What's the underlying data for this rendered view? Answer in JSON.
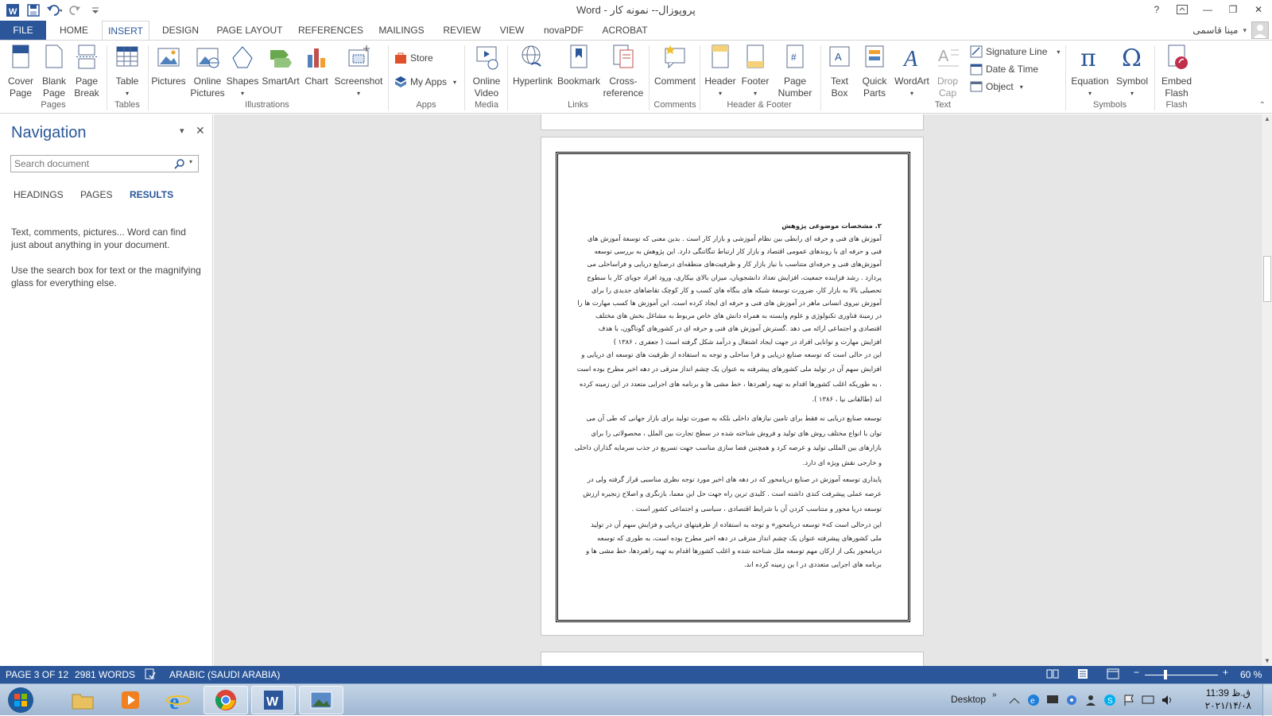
{
  "window": {
    "title": "Word - پروپوزال-- نمونه کار",
    "help": "?",
    "minimize": "—",
    "restore": "❐",
    "close": "✕"
  },
  "tabs": [
    "FILE",
    "HOME",
    "INSERT",
    "DESIGN",
    "PAGE LAYOUT",
    "REFERENCES",
    "MAILINGS",
    "REVIEW",
    "VIEW",
    "novaPDF",
    "ACROBAT"
  ],
  "active_tab": "INSERT",
  "user": {
    "name": "مینا قاسمی"
  },
  "ribbon": {
    "pages": {
      "label": "Pages",
      "cover": "Cover\nPage",
      "blank": "Blank\nPage",
      "break": "Page\nBreak"
    },
    "tables": {
      "label": "Tables",
      "table": "Table"
    },
    "illustrations": {
      "label": "Illustrations",
      "pictures": "Pictures",
      "online_pictures": "Online\nPictures",
      "shapes": "Shapes",
      "smartart": "SmartArt",
      "chart": "Chart",
      "screenshot": "Screenshot"
    },
    "apps": {
      "label": "Apps",
      "store": "Store",
      "my_apps": "My Apps"
    },
    "media": {
      "label": "Media",
      "online_video": "Online\nVideo"
    },
    "links": {
      "label": "Links",
      "hyperlink": "Hyperlink",
      "bookmark": "Bookmark",
      "cross_reference": "Cross-\nreference"
    },
    "comments": {
      "label": "Comments",
      "comment": "Comment"
    },
    "header_footer": {
      "label": "Header & Footer",
      "header": "Header",
      "footer": "Footer",
      "page_number": "Page\nNumber"
    },
    "text": {
      "label": "Text",
      "text_box": "Text\nBox",
      "quick_parts": "Quick\nParts",
      "wordart": "WordArt",
      "drop_cap": "Drop\nCap",
      "signature_line": "Signature Line",
      "date_time": "Date & Time",
      "object": "Object"
    },
    "symbols": {
      "label": "Symbols",
      "equation": "Equation",
      "symbol": "Symbol"
    },
    "flash": {
      "label": "Flash",
      "embed_flash": "Embed\nFlash"
    }
  },
  "navigation": {
    "title": "Navigation",
    "search_placeholder": "Search document",
    "tabs": [
      "HEADINGS",
      "PAGES",
      "RESULTS"
    ],
    "active_tab": "RESULTS",
    "hint1": "Text, comments, pictures... Word can find just about anything in your document.",
    "hint2": "Use the search box for text or the magnifying glass for everything else."
  },
  "document": {
    "heading": "۲. مشخصات موضوعی پژوهش",
    "lines": [
      "آموزش های فنی و حرفه ای رابطی بین نظام آموزشی و بازار کار است .  بدین معنی  که توسعة آموزش های",
      "فنی و حرفه ای با روندهای عمومی اقتصاد و بازار کار ارتباط  تنگاتنگی دارد. این پژوهش به بررسی توسعه",
      "آموزش‌های فنی و حرفه‌ای متناسب با نیاز بازار کار و ظرفیت‌های منطقه‌ای درصنایع دریایی و فراساحلی     می",
      "پردازد . رشد فزاینده جمعیت، افزایش تعداد دانشجویان، میزان بالای بیکاری، ورود افراد جویای کار با سطوح",
      "تحصیلی بالا به بازار کار، ضرورت توسعة شبکه های بنگاه های کسب و کار کوچک  تقاضاهای جدیدی را برای",
      "آموزش نیروی انسانی ماهر در آموزش های فنی و حرفه ای ایجاد کرده است. این آموزش ها کسب مهارت ها را",
      "در زمینة فناوری تکنولوژی و علوم وابسته به همراه دانش های خاص مربوط به مشاغل بخش های مختلف",
      "اقتصادی و اجتماعی ارائه می دهد .گسترش آموزش های فنی و حرفه ای در کشورهای گوناگون، با هدف",
      "افزایش مهارت و توانایی افراد در جهت ایجاد اشتغال و درآمد شکل گرفته است ( جعفری ، ۱۳۸۶ )",
      "این در حالی است که توسعه صنایع دریایی و فرا ساحلی و توجه به استفاده از ظرفیت های توسعه ای دریایی و",
      "افزایش سهم آن در تولید ملی کشورهای پیشرفته به عنوان یک چشم انداز مترقی در دهه اخیر مطرح بوده است",
      "، به طوریکه اغلب کشورها اقدام به تهیه راهبردها ، خط مشی ها و برنامه های اجرایی متعدد در این زمینه کرده",
      "اند (طالقانی نیا ، ۱۳۸۶ ).",
      "توسعه صنایع دریایی نه فقط برای تامین نیازهای داخلی بلکه به صورت تولید برای بازار جهانی که طی آن می",
      "توان با انواع مختلف روش های تولید و فروش شناخته شده در سطح تجارت بین الملل ، محصولاتی را برای",
      "بازارهای بین المللی تولید و عرضه کرد و همچنین فضا سازی مناسب جهت تسریع در جذب سرمایه گذاران داخلی",
      "و خارجی نقش ویژه ای دارد.",
      "پایداری توسعه آموزش  در صنایع دریامحور که در دهه های اخیر مورد توجه نظری مناسبی قرار گرفته ولی در",
      "عرصه عملی پیشرفت کندی داشته است . کلیدی ترین راه جهت حل این معما، بازنگری و اصلاح زنجیره ارزش",
      "توسعه دریا محور و متناسب کردن آن با شرایط اقتصادی ، سیاسی و اجتماعی کشور است .",
      "این درحالی است که« توسعه دریامحور»  و توجه به استفاده از ظرفیتهای دریایی و فزایش سهم آن در تولید",
      "ملی کشورهای پیشرفته عنوان یک چشم انداز مترقی در دهه اخیر مطرح بوده است، به طوری که توسعه",
      "دریامحور یکی از ارکان مهم توسعه ملل شناخته شده و اغلب کشورها اقدام به تهیه راهبردها، خط مشی ها و",
      "برنامه های اجرایی متعددی در ا ین زمینه کرده اند."
    ]
  },
  "status": {
    "page": "PAGE 3 OF 12",
    "words": "2981 WORDS",
    "language": "ARABIC (SAUDI ARABIA)",
    "zoom": "60 %",
    "zoom_level": 0.6
  },
  "taskbar": {
    "desktop": "Desktop",
    "time": "11:39 ق.ظ",
    "date": "۲۰۲۱/۱۴/۰۸"
  }
}
